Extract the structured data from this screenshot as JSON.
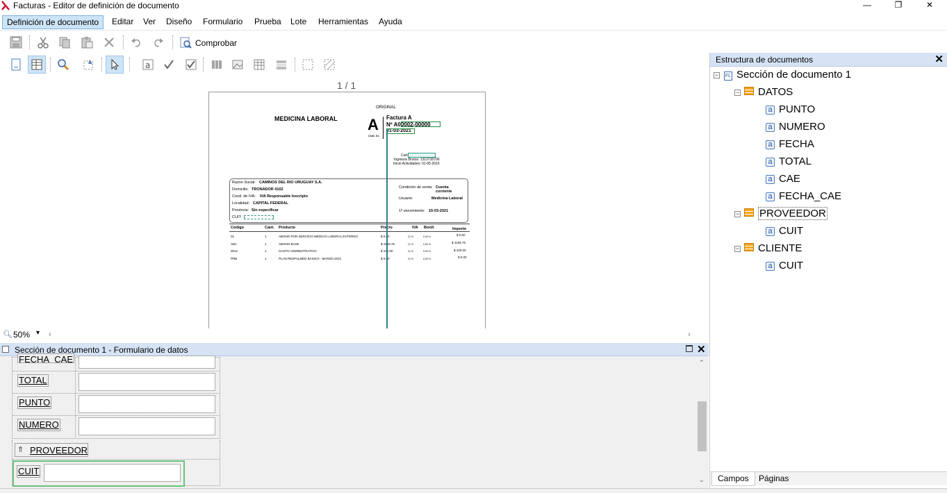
{
  "window": {
    "title": "Facturas - Editor de definición de documento",
    "minimize": "—",
    "restore": "❐",
    "close": "✕"
  },
  "menu": {
    "items": [
      "Definición de documento",
      "Editar",
      "Ver",
      "Diseño",
      "Formulario",
      "Prueba",
      "Lote",
      "Herramientas",
      "Ayuda"
    ]
  },
  "toolbar1": {
    "check_label": "Comprobar"
  },
  "canvas": {
    "page_indicator": "1 / 1",
    "zoom": "50%"
  },
  "document": {
    "original": "ORIGINAL",
    "company": "MEDICINA LABORAL",
    "letter": "A",
    "cod": "COD. 01",
    "invoice_type": "Factura A",
    "invoice_no": "Nº A00002-00000",
    "invoice_date": "01-03-2021",
    "cuit_label": "Cuit:",
    "ingresos": "Ingresos Brutos: 1313730706",
    "inicio": "Inicio Actividades: 01-05-2016",
    "razon_label": "Razon Social:",
    "razon": "CAMINOS DEL RIO URUGUAY S.A.",
    "domicilio_label": "Domicilio:",
    "domicilio": "TRONADOR 4102",
    "iva_label": "Cond. de IVA:",
    "iva": "IVA Responsable Inscripto",
    "localidad_label": "Localidad:",
    "localidad": "CAPITAL FEDERAL",
    "provincia_label": "Provincia:",
    "provincia": "Sin especificar",
    "cuit2_label": "CUIT:",
    "cond_venta_label": "Condición de venta:",
    "cond_venta": "Cuenta corriente",
    "usuario_label": "Usuario:",
    "usuario": "Medicina Laboral",
    "venc_label": "1º vencimiento:",
    "venc": "15-03-2021",
    "table_headers": [
      "Código",
      "Cant.",
      "Producto",
      "Precio",
      "IVA",
      "Bonif.",
      "Importe"
    ],
    "rows": [
      [
        "01",
        "1",
        "ABONO POR SERVICIO MEDICO LABORAL EXTERNO",
        "$ 0.00",
        "21 %",
        "0.00 %",
        "$ 0.00"
      ],
      [
        "AB1",
        "1",
        "ABONO BASE",
        "$ 4165.75",
        "21 %",
        "0.00 %",
        "$ 4165.75"
      ],
      [
        "0012",
        "1",
        "GASTO ADMINISTRATIVO",
        "$ 100.00",
        "21 %",
        "0.00 %",
        "$ 100.00"
      ],
      [
        "PRB",
        "1",
        "PLAN RESPALMED BASICO - MARZO 2021",
        "$ 0.00",
        "21 %",
        "0.00 %",
        "$ 0.00"
      ]
    ]
  },
  "structure_panel": {
    "title": "Estructura de documentos",
    "section": "Sección de documento 1",
    "groups": [
      {
        "name": "DATOS",
        "fields": [
          "PUNTO",
          "NUMERO",
          "FECHA",
          "TOTAL",
          "CAE",
          "FECHA_CAE"
        ]
      },
      {
        "name": "PROVEEDOR",
        "fields": [
          "CUIT"
        ]
      },
      {
        "name": "CLIENTE",
        "fields": [
          "CUIT"
        ]
      }
    ],
    "tabs": [
      "Campos",
      "Páginas"
    ]
  },
  "form_panel": {
    "title": "Sección de documento 1 - Formulario de datos",
    "fields": [
      "FECHA_CAE",
      "TOTAL",
      "PUNTO",
      "NUMERO"
    ],
    "group": "PROVEEDOR",
    "group_field": "CUIT"
  }
}
